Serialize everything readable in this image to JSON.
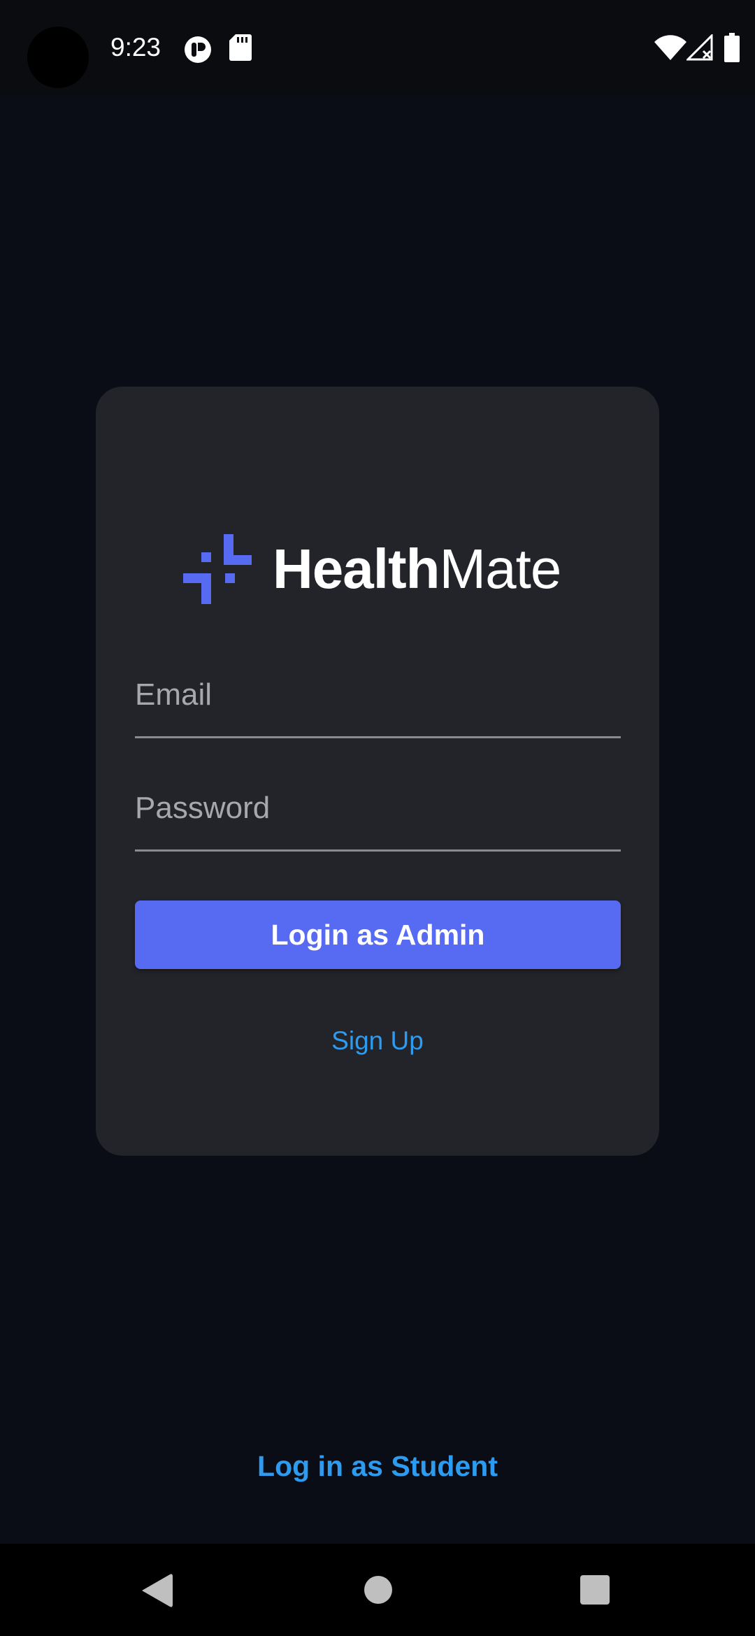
{
  "status_bar": {
    "time": "9:23",
    "icons": [
      "app-notification-icon",
      "sd-card-icon",
      "wifi-icon",
      "cellular-signal-no-service-icon",
      "battery-icon"
    ]
  },
  "app": {
    "name_bold": "Health",
    "name_light": "Mate",
    "brand_color": "#576bf2",
    "card_color": "#23242a",
    "background_color": "#0a0d15",
    "link_color": "#2d9cf0"
  },
  "login_form": {
    "email": {
      "value": "",
      "placeholder": "Email"
    },
    "password": {
      "value": "",
      "placeholder": "Password"
    },
    "admin_button_label": "Login as Admin",
    "signup_label": "Sign Up"
  },
  "footer": {
    "student_login_label": "Log in as Student"
  },
  "nav_bar": {
    "buttons": [
      "back-icon",
      "home-icon",
      "recents-icon"
    ]
  }
}
